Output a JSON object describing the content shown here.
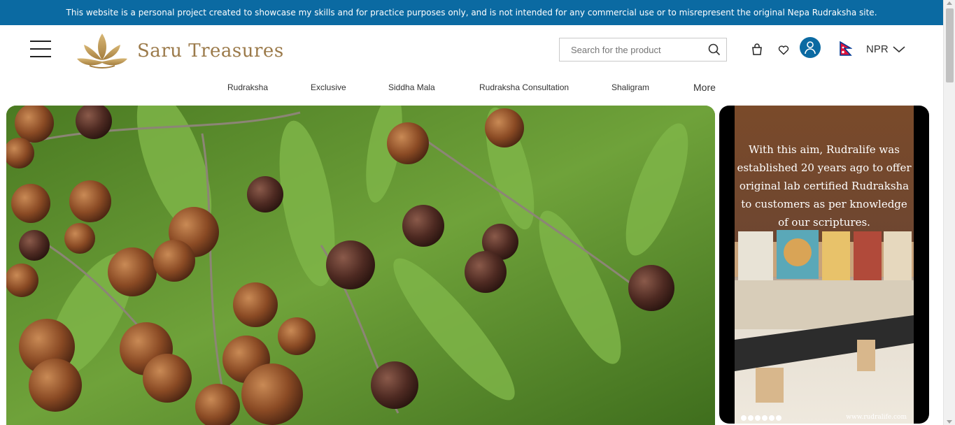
{
  "banner": {
    "text": "This website is a personal project created to showcase my skills and for practice purposes only, and is not intended for any commercial use or to misrepresent the original Nepa Rudraksha site."
  },
  "header": {
    "logo_text": "Saru Treasures",
    "search_placeholder": "Search for the product",
    "currency": "NPR",
    "icons": [
      "menu-icon",
      "search-icon",
      "cart-icon",
      "heart-icon",
      "user-icon",
      "nepal-flag-icon",
      "chevron-down-icon"
    ]
  },
  "nav": {
    "items": [
      "Rudraksha",
      "Exclusive",
      "Siddha Mala",
      "Rudraksha Consultation",
      "Shaligram",
      "More"
    ]
  },
  "hero": {
    "side_caption": "With this aim, Rudralife was established 20 years ago to offer original lab certified Rudraksha to customers as per knowledge of our scriptures.",
    "side_url": "www.rudralife.com"
  },
  "colors": {
    "banner": "#0b6aa2",
    "logo": "#9b7a4a",
    "accent": "#0b6aa2"
  }
}
